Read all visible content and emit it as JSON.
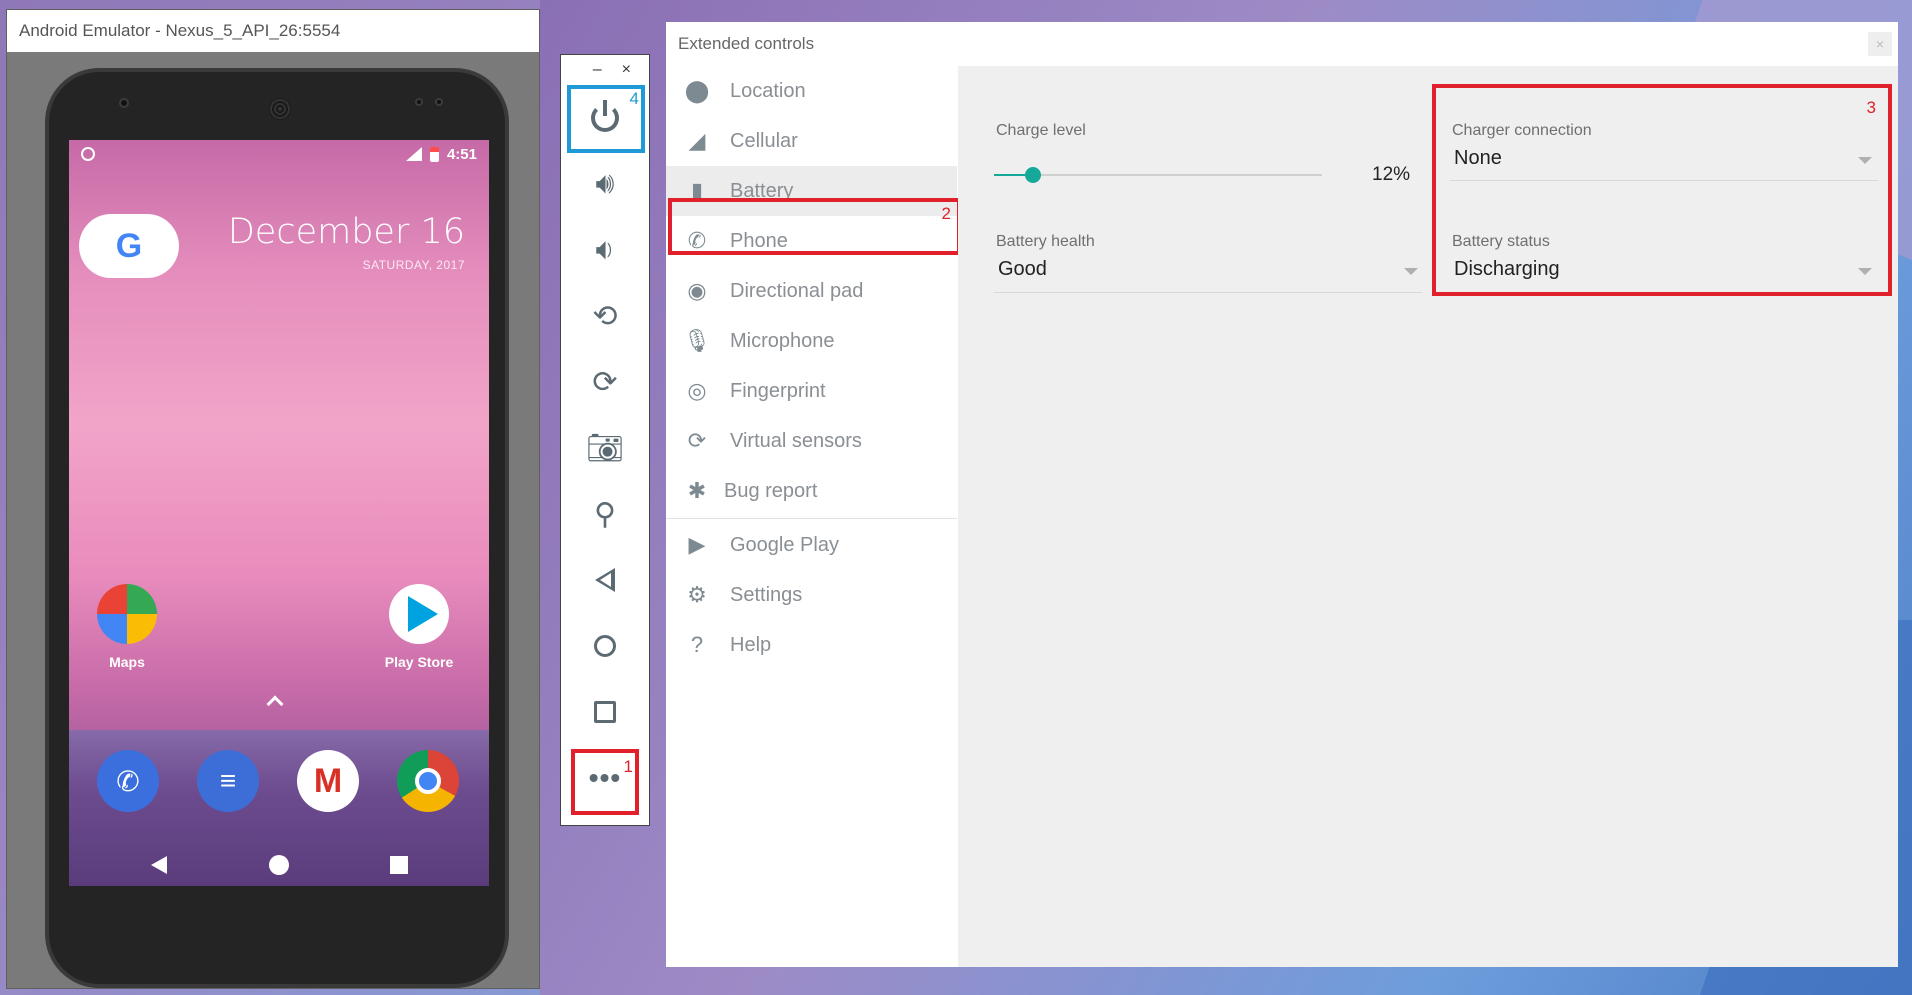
{
  "emulator": {
    "title": "Android Emulator - Nexus_5_API_26:5554",
    "phone": {
      "time": "4:51",
      "date_big": "December 16",
      "date_small": "SATURDAY, 2017",
      "apps": [
        {
          "label": "Maps"
        },
        {
          "label": "Play Store"
        }
      ]
    }
  },
  "toolbar": {
    "minimize": "–",
    "close": "×",
    "power_tag": "4",
    "more_tag": "1"
  },
  "extended": {
    "title": "Extended controls",
    "sidebar": [
      {
        "label": "Location",
        "icon": "location-pin-icon"
      },
      {
        "label": "Cellular",
        "icon": "cellular-signal-icon"
      },
      {
        "label": "Battery",
        "icon": "battery-icon",
        "active": true
      },
      {
        "label": "Phone",
        "icon": "phone-icon"
      },
      {
        "label": "Directional pad",
        "icon": "dpad-icon"
      },
      {
        "label": "Microphone",
        "icon": "microphone-icon"
      },
      {
        "label": "Fingerprint",
        "icon": "fingerprint-icon"
      },
      {
        "label": "Virtual sensors",
        "icon": "virtual-sensors-icon"
      },
      {
        "label": "Bug report",
        "icon": "bug-icon"
      },
      {
        "label": "Google Play",
        "icon": "google-play-icon"
      },
      {
        "label": "Settings",
        "icon": "gear-icon"
      },
      {
        "label": "Help",
        "icon": "help-icon"
      }
    ],
    "battery_tag": "2",
    "charge_level": {
      "label": "Charge level",
      "value_text": "12%",
      "value": 12
    },
    "battery_health": {
      "label": "Battery health",
      "value": "Good"
    },
    "charger_connection": {
      "label": "Charger connection",
      "value": "None"
    },
    "battery_status": {
      "label": "Battery status",
      "value": "Discharging"
    },
    "right_tag": "3"
  },
  "colors": {
    "highlight_red": "#e0202a",
    "highlight_blue": "#1e9ad6",
    "accent_teal": "#16a99a"
  }
}
